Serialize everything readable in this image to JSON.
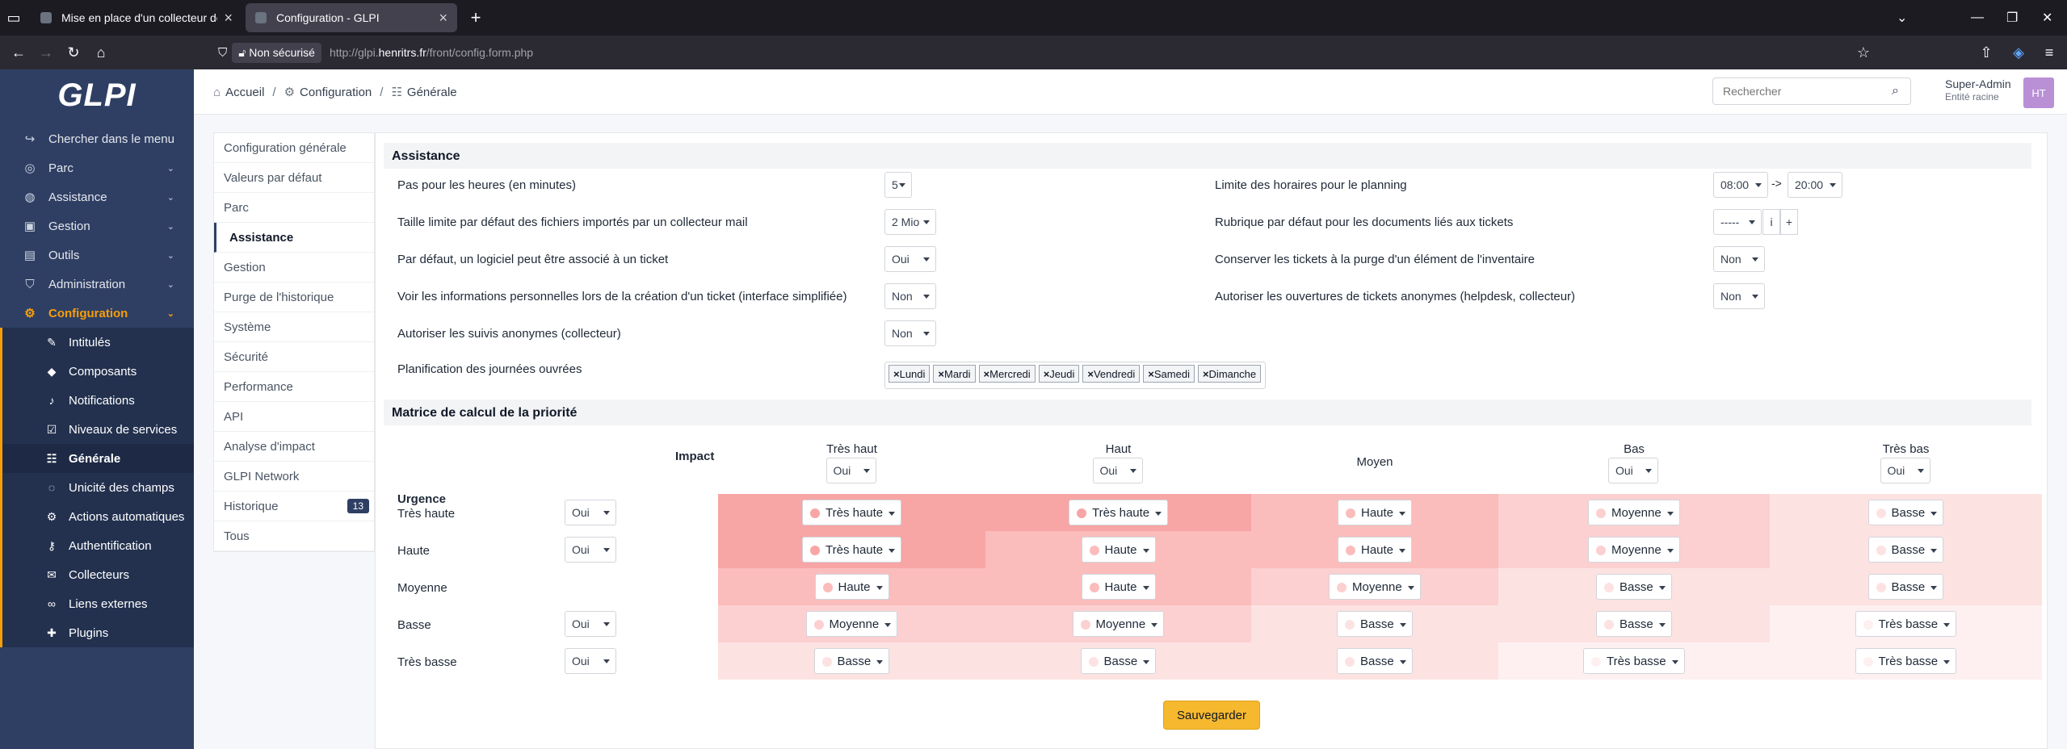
{
  "browser": {
    "tabs": [
      {
        "title": "Mise en place d'un collecteur de"
      },
      {
        "title": "Configuration - GLPI"
      }
    ],
    "security": "Non sécurisé",
    "url_prefix": "http://glpi.",
    "url_host": "henritrs.fr",
    "url_path": "/front/config.form.php"
  },
  "sidebar": {
    "logo": "GLPI",
    "search": "Chercher dans le menu",
    "menu": [
      "Parc",
      "Assistance",
      "Gestion",
      "Outils",
      "Administration",
      "Configuration"
    ],
    "submenu": [
      "Intitulés",
      "Composants",
      "Notifications",
      "Niveaux de services",
      "Générale",
      "Unicité des champs",
      "Actions automatiques",
      "Authentification",
      "Collecteurs",
      "Liens externes",
      "Plugins"
    ]
  },
  "header": {
    "breadcrumb": [
      "Accueil",
      "Configuration",
      "Générale"
    ],
    "search_placeholder": "Rechercher",
    "user_name": "Super-Admin",
    "user_entity": "Entité racine",
    "avatar": "HT"
  },
  "tabs": {
    "items": [
      "Configuration générale",
      "Valeurs par défaut",
      "Parc",
      "Assistance",
      "Gestion",
      "Purge de l'historique",
      "Système",
      "Sécurité",
      "Performance",
      "API",
      "Analyse d'impact",
      "GLPI Network",
      "Historique",
      "Tous"
    ],
    "history_count": "13"
  },
  "assistance": {
    "title": "Assistance",
    "step_label": "Pas pour les heures (en minutes)",
    "step_value": "5",
    "size_label": "Taille limite par défaut des fichiers importés par un collecteur mail",
    "size_value": "2 Mio",
    "soft_label": "Par défaut, un logiciel peut être associé à un ticket",
    "soft_value": "Oui",
    "personal_label": "Voir les informations personnelles lors de la création d'un ticket (interface simplifiée)",
    "personal_value": "Non",
    "anon_followup_label": "Autoriser les suivis anonymes (collecteur)",
    "anon_followup_value": "Non",
    "days_label": "Planification des journées ouvrées",
    "days": [
      "Lundi",
      "Mardi",
      "Mercredi",
      "Jeudi",
      "Vendredi",
      "Samedi",
      "Dimanche"
    ],
    "planning_label": "Limite des horaires pour le planning",
    "planning_from": "08:00",
    "planning_arrow": "->",
    "planning_to": "20:00",
    "rubric_label": "Rubrique par défaut pour les documents liés aux tickets",
    "rubric_value": "-----",
    "keep_label": "Conserver les tickets à la purge d'un élément de l'inventaire",
    "keep_value": "Non",
    "anon_open_label": "Autoriser les ouvertures de tickets anonymes (helpdesk, collecteur)",
    "anon_open_value": "Non"
  },
  "matrix": {
    "title": "Matrice de calcul de la priorité",
    "impact_label": "Impact",
    "urgency_label": "Urgence",
    "columns": [
      {
        "label": "Très haut",
        "enabled": "Oui"
      },
      {
        "label": "Haut",
        "enabled": "Oui"
      },
      {
        "label": "Moyen",
        "enabled": ""
      },
      {
        "label": "Bas",
        "enabled": "Oui"
      },
      {
        "label": "Très bas",
        "enabled": "Oui"
      }
    ],
    "rows": [
      {
        "label": "Très haute",
        "enabled": "Oui",
        "cells": [
          "Très haute",
          "Très haute",
          "Haute",
          "Moyenne",
          "Basse"
        ]
      },
      {
        "label": "Haute",
        "enabled": "Oui",
        "cells": [
          "Très haute",
          "Haute",
          "Haute",
          "Moyenne",
          "Basse"
        ]
      },
      {
        "label": "Moyenne",
        "enabled": "",
        "cells": [
          "Haute",
          "Haute",
          "Moyenne",
          "Basse",
          "Basse"
        ]
      },
      {
        "label": "Basse",
        "enabled": "Oui",
        "cells": [
          "Moyenne",
          "Moyenne",
          "Basse",
          "Basse",
          "Très basse"
        ]
      },
      {
        "label": "Très basse",
        "enabled": "Oui",
        "cells": [
          "Basse",
          "Basse",
          "Basse",
          "Très basse",
          "Très basse"
        ]
      }
    ],
    "colors": {
      "Très haute": "#f8a5a5",
      "Haute": "#fbbcbc",
      "Moyenne": "#fcd0d0",
      "Basse": "#fde2e2",
      "Très basse": "#fef0f0"
    },
    "save_label": "Sauvegarder"
  }
}
